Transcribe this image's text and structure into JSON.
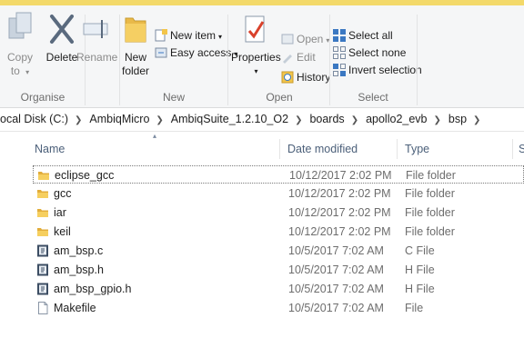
{
  "ribbon": {
    "organise": {
      "label": "Organise",
      "copy_to": "Copy\nto",
      "delete": "Delete",
      "rename": "Rename"
    },
    "new": {
      "label": "New",
      "new_folder_line1": "New",
      "new_folder_line2": "folder",
      "new_item": "New item",
      "easy_access": "Easy access"
    },
    "open": {
      "label": "Open",
      "properties": "Properties",
      "open": "Open",
      "edit": "Edit",
      "history": "History"
    },
    "select": {
      "label": "Select",
      "select_all": "Select all",
      "select_none": "Select none",
      "invert_selection": "Invert selection"
    }
  },
  "address": {
    "crumbs": [
      "ocal Disk (C:)",
      "AmbiqMicro",
      "AmbiqSuite_1.2.10_O2",
      "boards",
      "apollo2_evb",
      "bsp"
    ]
  },
  "columns": {
    "name": "Name",
    "date": "Date modified",
    "type": "Type",
    "size": "S"
  },
  "files": [
    {
      "name": "eclipse_gcc",
      "date": "10/12/2017 2:02 PM",
      "type": "File folder",
      "icon": "folder-icon"
    },
    {
      "name": "gcc",
      "date": "10/12/2017 2:02 PM",
      "type": "File folder",
      "icon": "folder-icon"
    },
    {
      "name": "iar",
      "date": "10/12/2017 2:02 PM",
      "type": "File folder",
      "icon": "folder-icon"
    },
    {
      "name": "keil",
      "date": "10/12/2017 2:02 PM",
      "type": "File folder",
      "icon": "folder-icon"
    },
    {
      "name": "am_bsp.c",
      "date": "10/5/2017 7:02 AM",
      "type": "C File",
      "icon": "source-file-icon"
    },
    {
      "name": "am_bsp.h",
      "date": "10/5/2017 7:02 AM",
      "type": "H File",
      "icon": "source-file-icon"
    },
    {
      "name": "am_bsp_gpio.h",
      "date": "10/5/2017 7:02 AM",
      "type": "H File",
      "icon": "source-file-icon"
    },
    {
      "name": "Makefile",
      "date": "10/5/2017 7:02 AM",
      "type": "File",
      "icon": "blank-file-icon"
    }
  ]
}
